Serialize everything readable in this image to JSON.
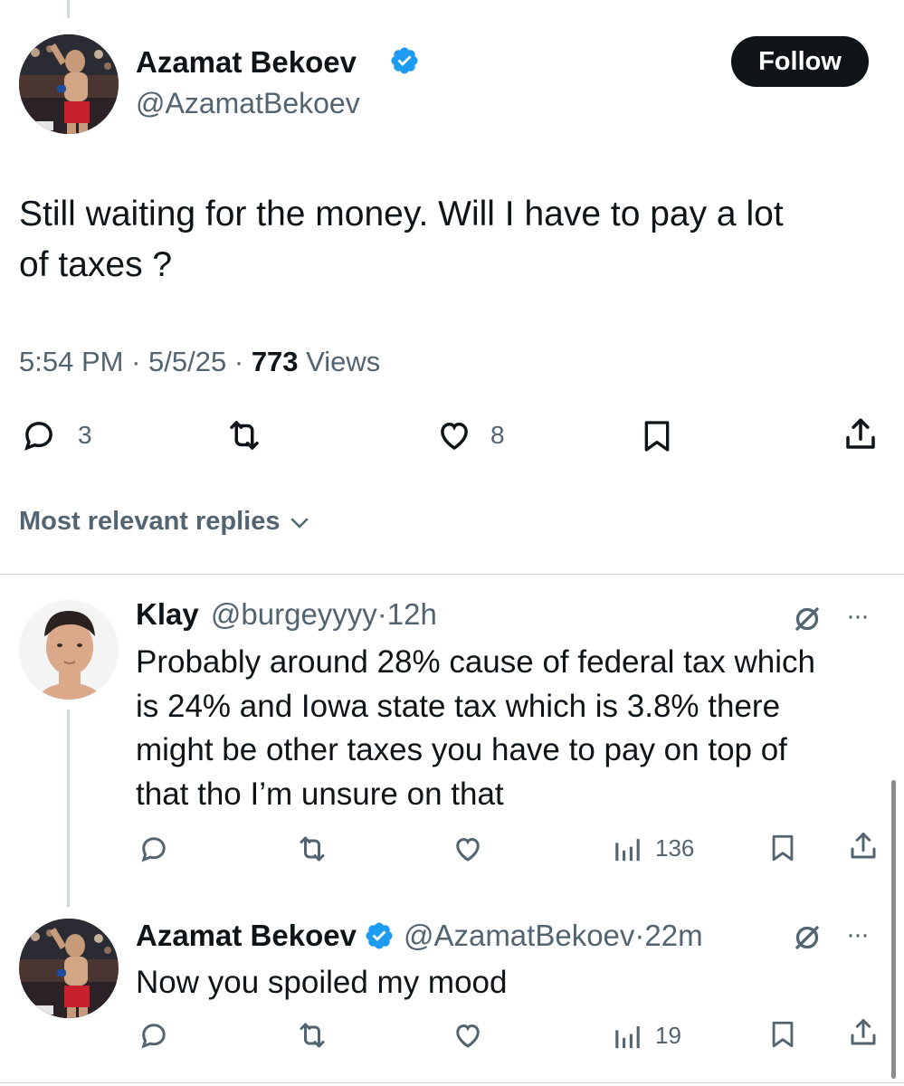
{
  "main_tweet": {
    "author_name": "Azamat Bekoev",
    "handle": "@AzamatBekoev",
    "follow_label": "Follow",
    "text_line1": "Still waiting for the money. Will I have to pay a lot",
    "text_line2": "of taxes ?",
    "time": "5:54 PM",
    "date": "5/5/25",
    "views_count": "773",
    "views_label": "Views",
    "reply_count": "3",
    "like_count": "8"
  },
  "replies_sort": {
    "label": "Most relevant replies"
  },
  "replies": [
    {
      "name": "Klay",
      "handle": "@burgeyyyy",
      "age": "12h",
      "lines": [
        "Probably around 28% cause of federal tax which",
        "is 24% and Iowa state tax which is 3.8% there",
        "might be other taxes you have to pay on top of",
        "that tho I’m unsure on that"
      ],
      "views": "136"
    },
    {
      "name": "Azamat Bekoev",
      "handle": "@AzamatBekoev",
      "age": "22m",
      "lines": [
        "Now you spoiled my mood"
      ],
      "views": "19"
    }
  ],
  "separator": "·",
  "colors": {
    "verified": "#1d9bf0",
    "text": "#0f1419",
    "muted": "#536471",
    "button": "#0f1419"
  }
}
